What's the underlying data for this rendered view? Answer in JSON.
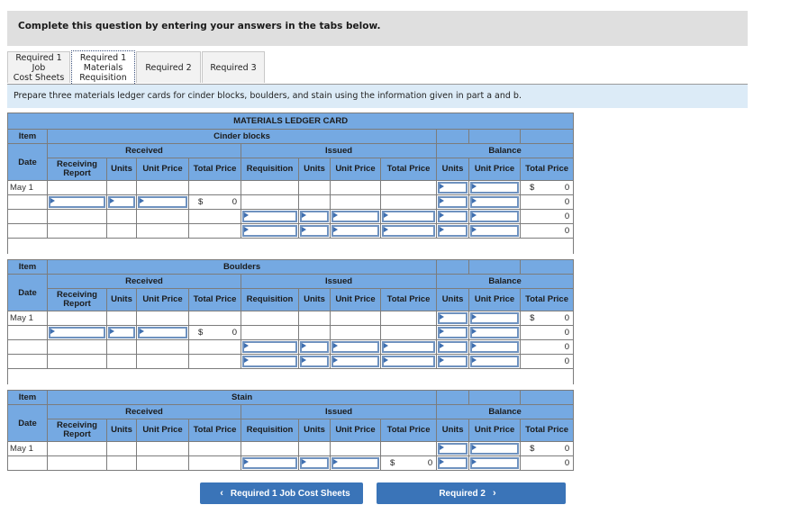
{
  "banner": {
    "text": "Complete this question by entering your answers in the tabs below."
  },
  "tabs": [
    {
      "line1": "Required 1 Job",
      "line2": "Cost Sheets",
      "line3": "",
      "active": false
    },
    {
      "line1": "Required 1",
      "line2": "Materials",
      "line3": "Requisition",
      "active": true
    },
    {
      "line1": "Required 2",
      "line2": "",
      "line3": "",
      "active": false
    },
    {
      "line1": "Required 3",
      "line2": "",
      "line3": "",
      "active": false
    }
  ],
  "instructions": "Prepare three materials ledger cards for cinder blocks, boulders, and stain using the information given in part a and b.",
  "ledger": {
    "title": "MATERIALS LEDGER CARD",
    "item_label": "Item",
    "date_label": "Date",
    "groups": {
      "received": "Received",
      "issued": "Issued",
      "balance": "Balance"
    },
    "columns": {
      "receiving_report": "Receiving Report",
      "units": "Units",
      "unit_price": "Unit Price",
      "total_price": "Total Price",
      "requisition": "Requisition"
    },
    "currency_symbol": "$",
    "cards": [
      {
        "item": "Cinder blocks",
        "date": "May 1",
        "received_total": "0",
        "balance_totals": [
          "0",
          "0",
          "0",
          "0"
        ]
      },
      {
        "item": "Boulders",
        "date": "May 1",
        "received_total": "0",
        "balance_totals": [
          "0",
          "0",
          "0",
          "0"
        ]
      },
      {
        "item": "Stain",
        "date": "May 1",
        "issued_total": "0",
        "balance_totals": [
          "0",
          "0"
        ]
      }
    ]
  },
  "nav": {
    "prev_label": "Required 1 Job Cost Sheets",
    "next_label": "Required 2",
    "prev_icon": "chevron-left-icon",
    "next_icon": "chevron-right-icon",
    "prev_glyph": "‹",
    "next_glyph": "›"
  }
}
